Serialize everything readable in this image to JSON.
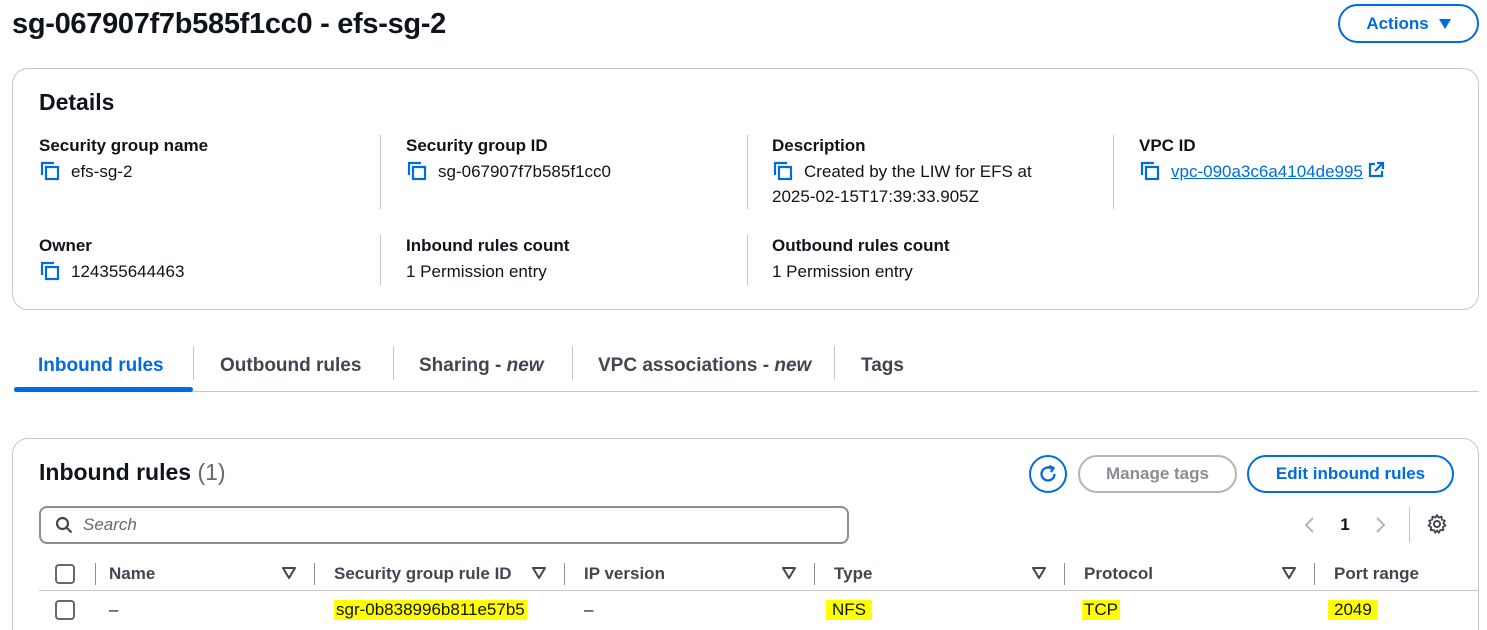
{
  "header": {
    "title": "sg-067907f7b585f1cc0 - efs-sg-2",
    "actions_label": "Actions"
  },
  "details": {
    "heading": "Details",
    "security_group_name": {
      "label": "Security group name",
      "value": "efs-sg-2"
    },
    "security_group_id": {
      "label": "Security group ID",
      "value": "sg-067907f7b585f1cc0"
    },
    "description": {
      "label": "Description",
      "value_line1": "Created by the LIW for EFS at",
      "value_line2": "2025-02-15T17:39:33.905Z"
    },
    "vpc_id": {
      "label": "VPC ID",
      "value": "vpc-090a3c6a4104de995"
    },
    "owner": {
      "label": "Owner",
      "value": "124355644463"
    },
    "inbound_rules_count": {
      "label": "Inbound rules count",
      "value": "1 Permission entry"
    },
    "outbound_rules_count": {
      "label": "Outbound rules count",
      "value": "1 Permission entry"
    }
  },
  "tabs": [
    {
      "label": "Inbound rules",
      "suffix": "",
      "active": true
    },
    {
      "label": "Outbound rules",
      "suffix": ""
    },
    {
      "label": "Sharing - ",
      "suffix": "new"
    },
    {
      "label": "VPC associations - ",
      "suffix": "new"
    },
    {
      "label": "Tags",
      "suffix": ""
    }
  ],
  "inbound": {
    "title": "Inbound rules",
    "count": "(1)",
    "manage_tags_label": "Manage tags",
    "edit_label": "Edit inbound rules",
    "search_placeholder": "Search",
    "page": "1",
    "columns": [
      "Name",
      "Security group rule ID",
      "IP version",
      "Type",
      "Protocol",
      "Port range"
    ],
    "rows": [
      {
        "name": "–",
        "rule_id": "sgr-0b838996b811e57b5",
        "ip_version": "–",
        "type": "NFS",
        "protocol": "TCP",
        "port_range": "2049"
      }
    ]
  },
  "colors": {
    "primary": "#006ce0",
    "text": "#0f141a",
    "border": "#c6c6cd",
    "highlight": "#ffff00",
    "disabled": "#8c8c94"
  }
}
